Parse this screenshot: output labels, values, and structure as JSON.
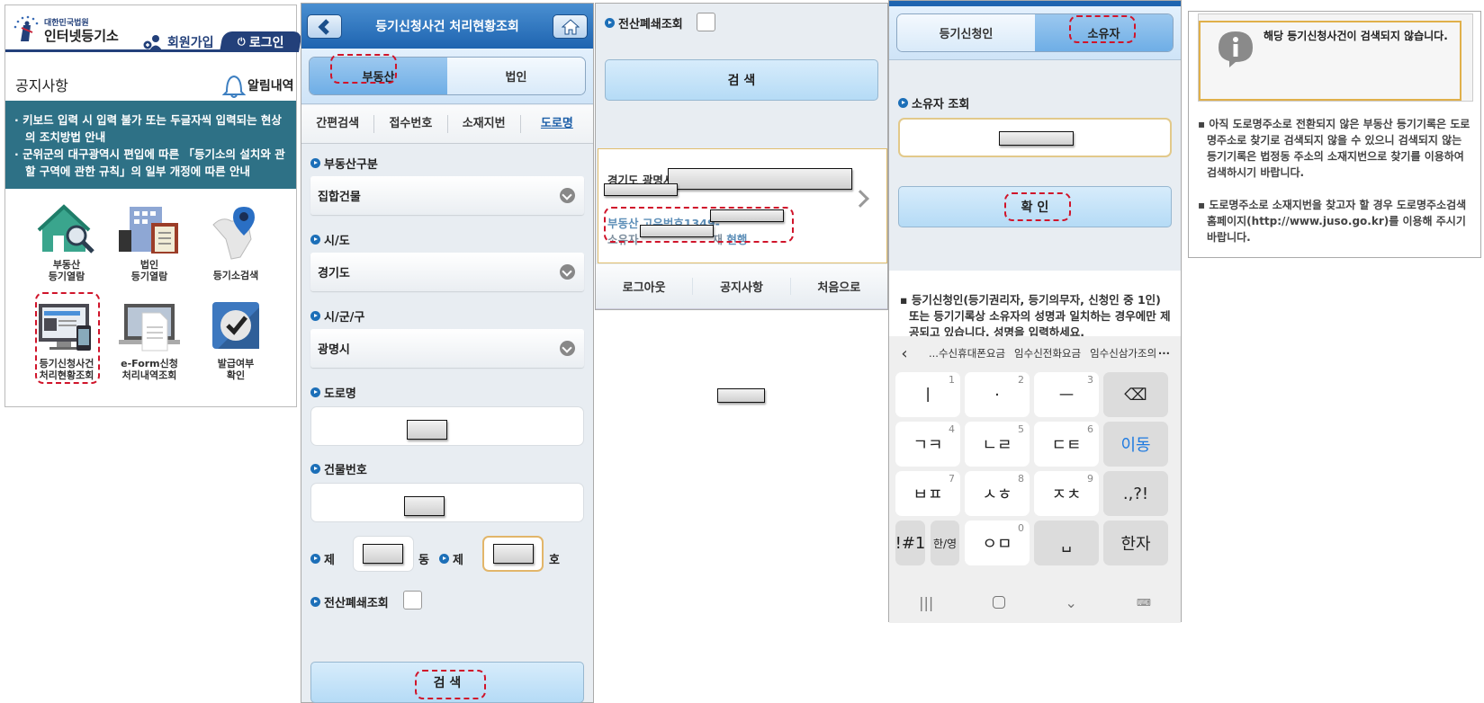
{
  "panel1": {
    "logo_sub": "대한민국법원",
    "logo_main": "인터넷등기소",
    "join_label": "회원가입",
    "login_label": "로그인",
    "notice_title": "공지사항",
    "alarm_label": "알림내역",
    "notices": [
      "키보드 입력 시 입력 불가 또는 두글자씩 입력되는 현상의 조치방법 안내",
      "군위군의 대구광역시 편입에 따른 「등기소의 설치와 관할 구역에 관한 규칙」의 일부 개정에 따른 안내"
    ],
    "menu": [
      {
        "line1": "부동산",
        "line2": "등기열람",
        "icon": "house-search-icon"
      },
      {
        "line1": "법인",
        "line2": "등기열람",
        "icon": "building-clipboard-icon"
      },
      {
        "line1": "",
        "line2": "등기소검색",
        "icon": "map-pin-icon"
      },
      {
        "line1": "등기신청사건",
        "line2": "처리현황조회",
        "icon": "monitor-phone-icon",
        "highlighted": true
      },
      {
        "line1": "e-Form신청",
        "line2": "처리내역조회",
        "icon": "laptop-document-icon"
      },
      {
        "line1": "발급여부",
        "line2": "확인",
        "icon": "checkmark-icon"
      }
    ]
  },
  "panel2": {
    "title": "등기신청사건 처리현황조회",
    "segments": [
      "부동산",
      "법인"
    ],
    "active_segment": "부동산",
    "subtabs": [
      "간편검색",
      "접수번호",
      "소재지번",
      "도로명"
    ],
    "active_subtab": "도로명",
    "fields": {
      "property_type_label": "부동산구분",
      "property_type_value": "집합건물",
      "sido_label": "시/도",
      "sido_value": "경기도",
      "sigungu_label": "시/군/구",
      "sigungu_value": "광명시",
      "road_label": "도로명",
      "building_no_label": "건물번호",
      "dong_prefix": "제",
      "dong_suffix": "동",
      "ho_prefix": "제",
      "ho_suffix": "호",
      "closed_label": "전산폐쇄조회"
    },
    "search_label": "검 색"
  },
  "panel3": {
    "closed_label": "전산폐쇄조회",
    "search_label": "검 색",
    "result": {
      "address_prefix": "경기도 광명시",
      "unique_no_prefix": "부동산 고유번호1349-",
      "owner_prefix": "소유자",
      "owner_suffix_partial": "재",
      "status": "현행"
    },
    "footer": [
      "로그아웃",
      "공지사항",
      "처음으로"
    ]
  },
  "panel4": {
    "segments": [
      "등기신청인",
      "소유자"
    ],
    "active_segment": "소유자",
    "owner_query_label": "소유자 조회",
    "confirm_label": "확 인",
    "info": "등기신청인(등기권리자, 등기의무자, 신청인 중 1인) 또는 등기기록상 소유자의 성명과 일치하는 경우에만 제공되고 있습니다. 성명을 입력하세요.",
    "keyboard": {
      "suggestions": [
        "...수신휴대폰요금",
        "임수신전화요금",
        "임수신삼가조의"
      ],
      "rows": [
        [
          {
            "label": "ㅣ",
            "num": "1"
          },
          {
            "label": "·",
            "num": "2"
          },
          {
            "label": "ㅡ",
            "num": "3"
          },
          {
            "label": "⌫",
            "gray": true
          }
        ],
        [
          {
            "label": "ㄱㅋ",
            "num": "4"
          },
          {
            "label": "ㄴㄹ",
            "num": "5"
          },
          {
            "label": "ㄷㅌ",
            "num": "6"
          },
          {
            "label": "이동",
            "gray": true,
            "accent": true
          }
        ],
        [
          {
            "label": "ㅂㅍ",
            "num": "7"
          },
          {
            "label": "ㅅㅎ",
            "num": "8"
          },
          {
            "label": "ㅈㅊ",
            "num": "9"
          },
          {
            "label": ".,?!",
            "gray": true
          }
        ]
      ],
      "bottom_row": {
        "symbols": "!#1",
        "lang": "한/영",
        "om": "ㅇㅁ",
        "om_num": "0",
        "space": "␣",
        "hanja": "한자"
      },
      "accent_color": "#1e7ae0"
    }
  },
  "panel5": {
    "alert": "해당 등기신청사건이 검색되지 않습니다.",
    "notes": [
      "아직 도로명주소로 전환되지 않은 부동산 등기기록은 도로명주소로 찾기로 검색되지 않을 수 있으니 검색되지 않는 등기기록은 법정동 주소의 소재지번으로 찾기를 이용하여 검색하시기 바랍니다.",
      "도로명주소로 소재지번을 찾고자 할 경우 도로명주소검색 홈페이지(http://www.juso.go.kr)를 이용해 주시기 바랍니다."
    ]
  },
  "colors": {
    "header_navy": "#23407a",
    "notice_teal": "#2e7186",
    "topbar_blue": "#1e64b0",
    "highlight_red": "#d0142a",
    "focus_gold": "#e2b66a"
  }
}
